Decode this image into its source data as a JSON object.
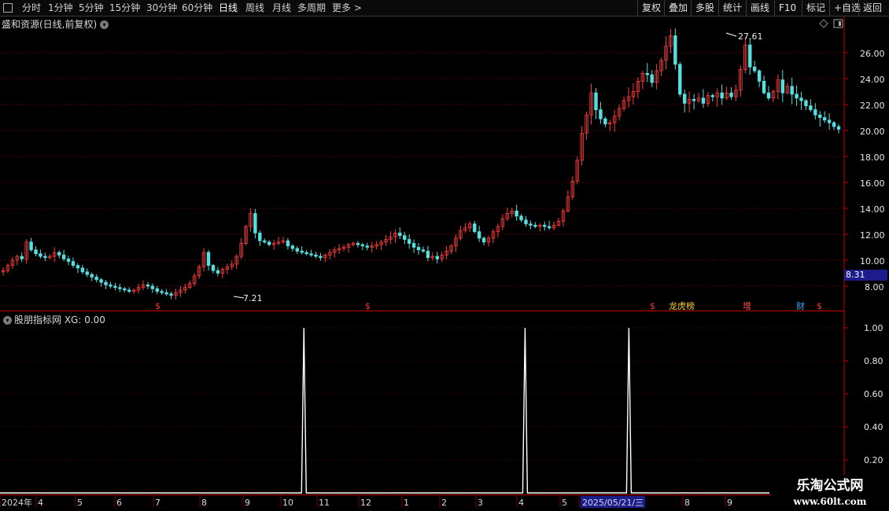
{
  "toolbar": {
    "left_items": [
      "分时",
      "1分钟",
      "5分钟",
      "15分钟",
      "30分钟",
      "60分钟",
      "日线",
      "周线",
      "月线",
      "多周期",
      "更多 >"
    ],
    "active": "日线",
    "right_items": [
      "复权",
      "叠加",
      "多股",
      "统计",
      "画线",
      "F10",
      "标记",
      "+自选",
      "返回"
    ]
  },
  "main_title": "盛和资源(日线,前复权)",
  "sub_title": "股朋指标网 XG: 0.00",
  "price_badge": "8.31",
  "annotations": {
    "high": "27.61",
    "low": "7.21"
  },
  "event_markers": [
    {
      "label": "$",
      "color": "#ff3030"
    },
    {
      "label": "$",
      "color": "#ff3030"
    },
    {
      "label": "$",
      "color": "#ff3030"
    },
    {
      "label": "龙虎榜",
      "color": "#ffcc33"
    },
    {
      "label": "增",
      "color": "#ff5050"
    },
    {
      "label": "财",
      "color": "#33aaff"
    },
    {
      "label": "$",
      "color": "#ff3030"
    }
  ],
  "watermark": {
    "line1": "乐淘公式网",
    "line2": "www.60lt.com"
  },
  "colors": {
    "up": "#ff3b3b",
    "down": "#54e0e0",
    "axis": "#c80000",
    "signal": "#ffffff",
    "price_badge": "#1c1c8c"
  },
  "chart_data": [
    {
      "type": "candlestick",
      "title": "盛和资源(日线,前复权)",
      "y_ticks": [
        "26.00",
        "24.00",
        "22.00",
        "20.00",
        "18.00",
        "16.00",
        "14.00",
        "12.00",
        "10.00",
        "8.00"
      ],
      "ylim": [
        6.2,
        28.2
      ],
      "grid": true,
      "x_labels": [
        "2024年",
        "4",
        "5",
        "6",
        "7",
        "8",
        "9",
        "10",
        "11",
        "12",
        "1",
        "2",
        "3",
        "4",
        "5",
        "2025/05/21/三",
        "8",
        "9"
      ],
      "close_series": [
        9.2,
        9.6,
        10.0,
        10.3,
        10.1,
        11.4,
        10.8,
        10.5,
        10.3,
        10.2,
        10.3,
        10.6,
        10.4,
        10.1,
        9.9,
        9.6,
        9.4,
        9.1,
        8.9,
        8.7,
        8.5,
        8.3,
        8.1,
        8.0,
        7.9,
        7.8,
        7.7,
        7.6,
        7.7,
        7.9,
        8.1,
        8.0,
        7.8,
        7.6,
        7.5,
        7.4,
        7.3,
        7.5,
        7.7,
        7.9,
        8.2,
        8.8,
        9.5,
        10.6,
        9.6,
        9.2,
        9.0,
        9.3,
        9.5,
        9.7,
        10.3,
        11.3,
        12.6,
        13.6,
        12.1,
        11.5,
        11.4,
        11.2,
        11.3,
        11.4,
        11.5,
        11.1,
        10.9,
        10.7,
        10.6,
        10.5,
        10.4,
        10.3,
        10.2,
        10.4,
        10.6,
        10.8,
        10.9,
        11.0,
        11.2,
        11.3,
        11.2,
        11.1,
        11.0,
        11.1,
        11.2,
        11.4,
        11.6,
        11.8,
        12.1,
        11.9,
        11.6,
        11.3,
        11.0,
        10.8,
        10.7,
        10.2,
        10.3,
        10.1,
        10.4,
        10.7,
        11.1,
        11.7,
        12.3,
        12.5,
        12.8,
        12.2,
        11.7,
        11.4,
        11.7,
        12.2,
        12.6,
        13.2,
        13.6,
        13.8,
        13.4,
        13.1,
        12.8,
        12.7,
        12.6,
        12.7,
        12.6,
        12.5,
        12.7,
        13.0,
        13.8,
        14.9,
        16.1,
        17.7,
        19.8,
        21.2,
        22.9,
        21.6,
        20.9,
        20.5,
        20.6,
        21.1,
        21.7,
        22.3,
        22.6,
        23.0,
        23.8,
        24.4,
        24.3,
        23.7,
        24.6,
        25.4,
        26.5,
        27.3,
        25.1,
        22.8,
        22.1,
        22.4,
        22.3,
        22.5,
        22.1,
        22.7,
        22.6,
        22.9,
        22.5,
        22.9,
        22.6,
        23.1,
        24.7,
        26.6,
        24.9,
        24.6,
        23.8,
        22.9,
        22.5,
        23.0,
        23.9,
        22.9,
        23.4,
        22.8,
        22.5,
        22.3,
        21.9,
        21.6,
        21.2,
        21.0,
        20.8,
        20.6,
        20.3,
        20.1
      ]
    },
    {
      "type": "line",
      "title": "股朋指标网 XG: 0.00",
      "series": [
        {
          "name": "XG",
          "spikes_at_x_fraction": [
            0.36,
            0.622,
            0.745
          ],
          "values": [
            1.0,
            1.0,
            1.0
          ]
        }
      ],
      "y_ticks": [
        "1.00",
        "0.80",
        "0.60",
        "0.40",
        "0.20"
      ],
      "ylim": [
        0,
        1.05
      ]
    }
  ]
}
